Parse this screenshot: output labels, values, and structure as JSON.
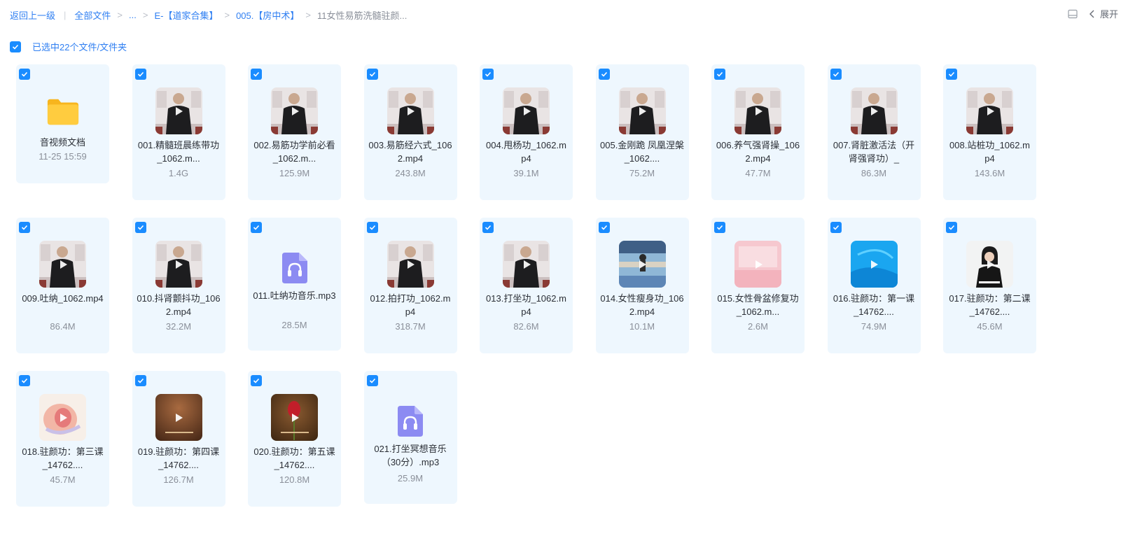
{
  "breadcrumb": {
    "back": "返回上一级",
    "items": [
      "全部文件",
      "...",
      "E-【道家合集】",
      "005.【房中术】"
    ],
    "current": "11女性易筋洗髓驻颜..."
  },
  "toolbar": {
    "expand_label": "展开"
  },
  "selection": {
    "label": "已选中22个文件/文件夹"
  },
  "colors": {
    "accent": "#2f7ff2",
    "checkbox": "#1a8cff",
    "tile_bg": "#eef7fe",
    "folder": "#ffc940",
    "audio": "#8e8cf4"
  },
  "files": [
    {
      "name": "音视频文档",
      "meta": "11-25 15:59",
      "kind": "folder",
      "icon": "folder-icon"
    },
    {
      "name": "001.精髓班晨练带功_1062.m...",
      "meta": "1.4G",
      "kind": "video",
      "thumb": "man-light"
    },
    {
      "name": "002.易筋功学前必看_1062.m...",
      "meta": "125.9M",
      "kind": "video",
      "thumb": "man-light"
    },
    {
      "name": "003.易筋经六式_1062.mp4",
      "meta": "243.8M",
      "kind": "video",
      "thumb": "man-light"
    },
    {
      "name": "004.甩杨功_1062.mp4",
      "meta": "39.1M",
      "kind": "video",
      "thumb": "man-light"
    },
    {
      "name": "005.金刚跪 凤凰涅槃_1062....",
      "meta": "75.2M",
      "kind": "video",
      "thumb": "man-light"
    },
    {
      "name": "006.养气强肾操_1062.mp4",
      "meta": "47.7M",
      "kind": "video",
      "thumb": "man-light"
    },
    {
      "name": "007.肾脏激活法（开肾强肾功）_",
      "meta": "86.3M",
      "kind": "video",
      "thumb": "man-light"
    },
    {
      "name": "008.站桩功_1062.mp4",
      "meta": "143.6M",
      "kind": "video",
      "thumb": "man-light"
    },
    {
      "name": "009.吐纳_1062.mp4",
      "meta": "86.4M",
      "kind": "video",
      "thumb": "man-light"
    },
    {
      "name": "010.抖肾颤抖功_1062.mp4",
      "meta": "32.2M",
      "kind": "video",
      "thumb": "man-light"
    },
    {
      "name": "011.吐纳功音乐.mp3",
      "meta": "28.5M",
      "kind": "audio",
      "icon": "headphones-icon"
    },
    {
      "name": "012.拍打功_1062.mp4",
      "meta": "318.7M",
      "kind": "video",
      "thumb": "man-light"
    },
    {
      "name": "013.打坐功_1062.mp4",
      "meta": "82.6M",
      "kind": "video",
      "thumb": "man-light"
    },
    {
      "name": "014.女性瘦身功_1062.mp4",
      "meta": "10.1M",
      "kind": "video",
      "thumb": "yoga"
    },
    {
      "name": "015.女性骨盆修复功_1062.m...",
      "meta": "2.6M",
      "kind": "video",
      "thumb": "pink"
    },
    {
      "name": "016.驻颜功：第一课_14762....",
      "meta": "74.9M",
      "kind": "video",
      "thumb": "blue"
    },
    {
      "name": "017.驻颜功：第二课_14762....",
      "meta": "45.6M",
      "kind": "video",
      "thumb": "woman"
    },
    {
      "name": "018.驻颜功：第三课_14762....",
      "meta": "45.7M",
      "kind": "video",
      "thumb": "anatomy"
    },
    {
      "name": "019.驻颜功：第四课_14762....",
      "meta": "126.7M",
      "kind": "video",
      "thumb": "brown"
    },
    {
      "name": "020.驻颜功：第五课_14762....",
      "meta": "120.8M",
      "kind": "video",
      "thumb": "rose"
    },
    {
      "name": "021.打坐冥想音乐（30分）.mp3",
      "meta": "25.9M",
      "kind": "audio",
      "icon": "headphones-icon"
    }
  ]
}
